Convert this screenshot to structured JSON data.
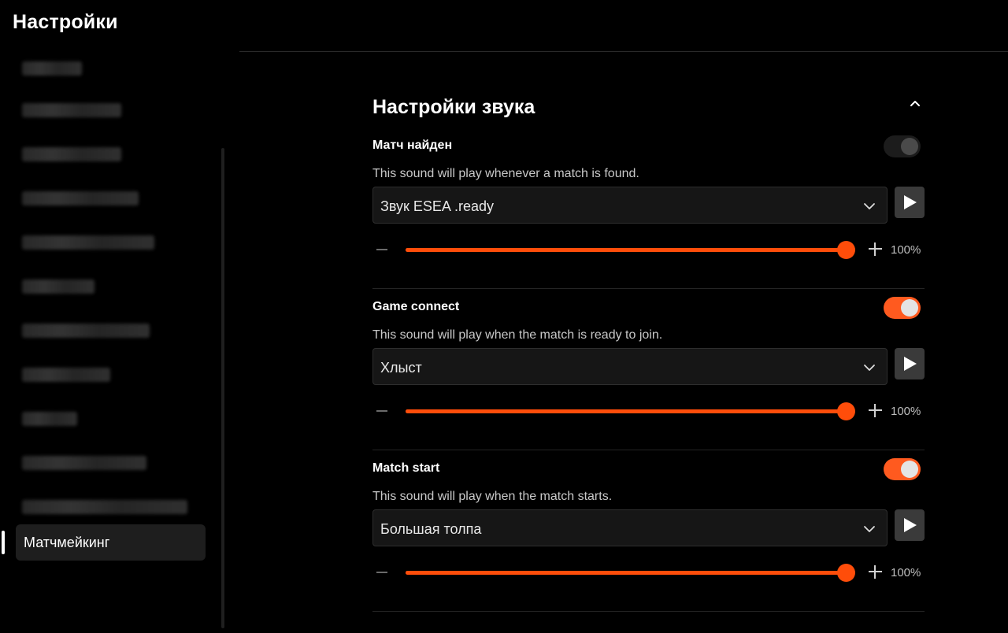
{
  "header": {
    "title": "Настройки"
  },
  "sidebar": {
    "active_item": "Матчмейкинг"
  },
  "section": {
    "title": "Настройки звука"
  },
  "sounds": [
    {
      "name": "Матч найден",
      "description": "This sound will play whenever a match is found.",
      "enabled": false,
      "selected_sound": "Звук ESEA .ready",
      "volume_percent": 100,
      "volume_label": "100%"
    },
    {
      "name": "Game connect",
      "description": "This sound will play when the match is ready to join.",
      "enabled": true,
      "selected_sound": "Хлыст",
      "volume_percent": 100,
      "volume_label": "100%"
    },
    {
      "name": "Match start",
      "description": "This sound will play when the match starts.",
      "enabled": true,
      "selected_sound": "Большая толпа",
      "volume_percent": 100,
      "volume_label": "100%"
    }
  ],
  "colors": {
    "accent": "#ff4d0a",
    "background": "#000000"
  }
}
